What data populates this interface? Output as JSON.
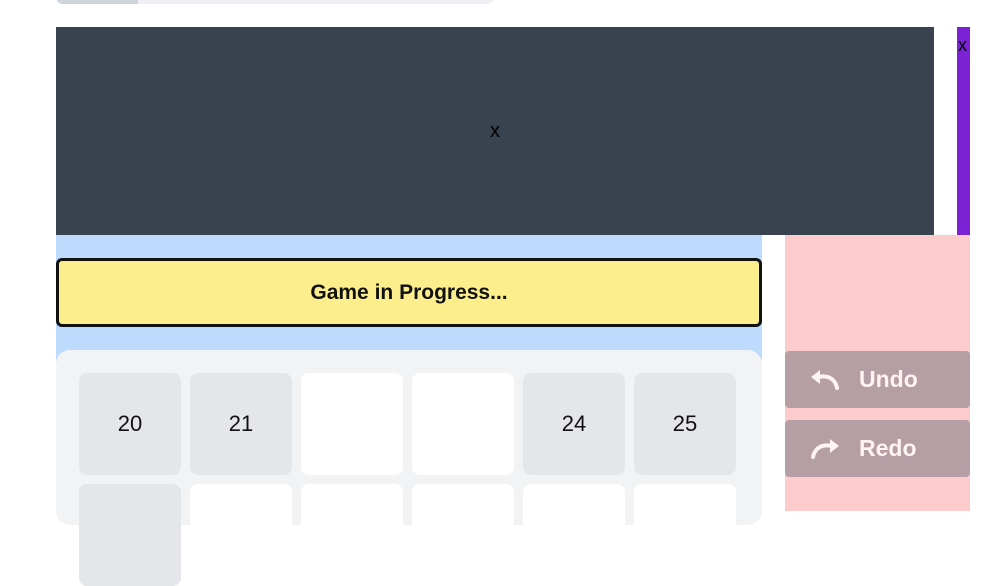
{
  "panels": {
    "main_placeholder": "x",
    "side_placeholder": "x"
  },
  "status": {
    "text": "Game in Progress..."
  },
  "board": {
    "row1": [
      "20",
      "21",
      "",
      "",
      "24",
      "25"
    ],
    "row2": [
      "",
      "",
      "",
      "",
      "",
      ""
    ]
  },
  "controls": {
    "undo_label": "Undo",
    "redo_label": "Redo",
    "undo_icon": "undo-arrow",
    "redo_icon": "redo-arrow"
  },
  "colors": {
    "dark_panel": "#39424f",
    "accent_purple": "#7b22d4",
    "banner_yellow": "#fcee8c",
    "board_blue": "#bedbfe",
    "side_pink": "#fccbcb",
    "button_mauve": "#b69ea5"
  }
}
